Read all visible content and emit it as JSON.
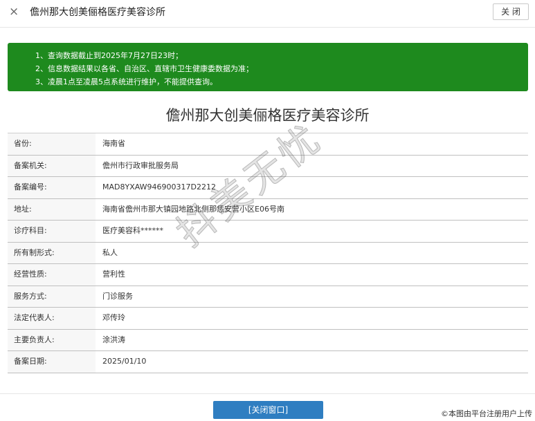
{
  "header": {
    "close_x_icon": "×",
    "title": "儋州那大创美俪格医疗美容诊所",
    "close_label": "关 闭"
  },
  "notice": {
    "lines": [
      "1、查询数据截止到2025年7月27日23时；",
      "2、信息数据结果以各省、自治区、直辖市卫生健康委数据为准；",
      "3、凌晨1点至凌晨5点系统进行维护，不能提供查询。"
    ]
  },
  "main_title": "儋州那大创美俪格医疗美容诊所",
  "rows": [
    {
      "label": "省份:",
      "value": "海南省"
    },
    {
      "label": "备案机关:",
      "value": "儋州市行政审批服务局"
    },
    {
      "label": "备案编号:",
      "value": "MAD8YXAW946900317D2212"
    },
    {
      "label": "地址:",
      "value": "海南省儋州市那大镇园地路北侧那恁安营小区E06号南"
    },
    {
      "label": "诊疗科目:",
      "value": "医疗美容科******"
    },
    {
      "label": "所有制形式:",
      "value": "私人"
    },
    {
      "label": "经营性质:",
      "value": "营利性"
    },
    {
      "label": "服务方式:",
      "value": "门诊服务"
    },
    {
      "label": "法定代表人:",
      "value": "邓传玲"
    },
    {
      "label": "主要负责人:",
      "value": "涂洪涛"
    },
    {
      "label": "备案日期:",
      "value": "2025/01/10"
    }
  ],
  "footer": {
    "close_window_label": "[关闭窗口]"
  },
  "watermark": "抖美无忧",
  "upload_note": "©本图由平台注册用户上传",
  "colors": {
    "notice_bg": "#1e8a1e",
    "button_bg": "#2f7ec1",
    "label_bg": "#f7f7f7"
  }
}
